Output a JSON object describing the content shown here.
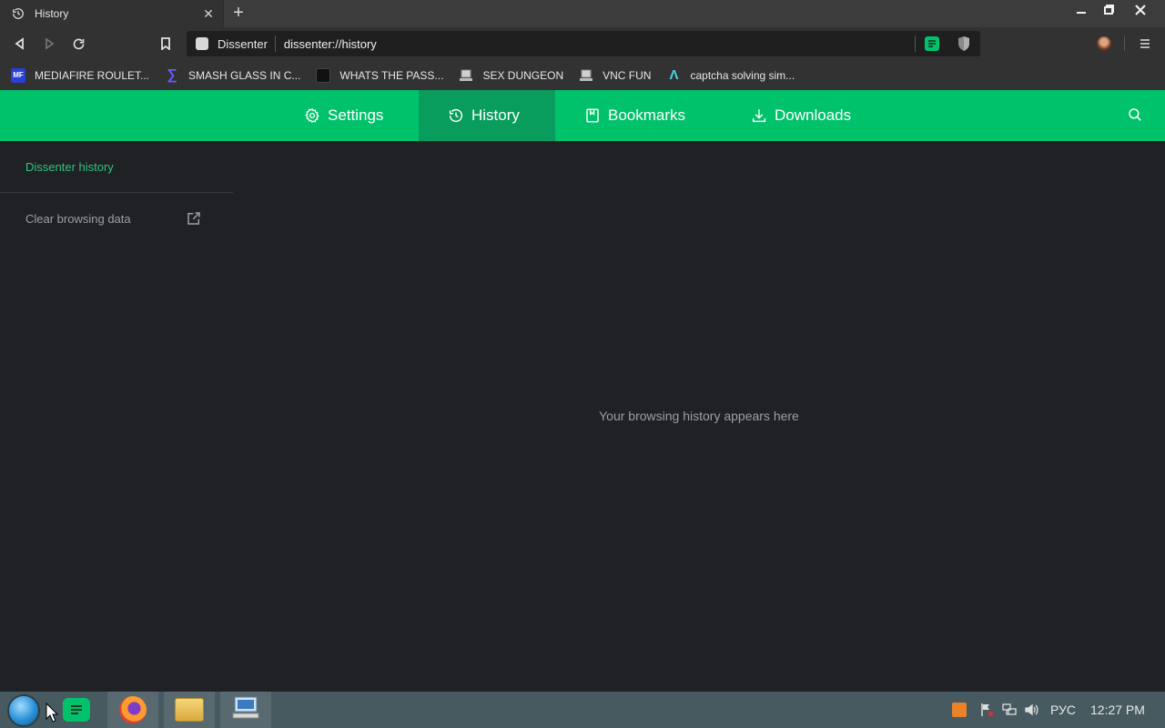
{
  "browser": {
    "tab": {
      "title": "History",
      "icon": "history-icon"
    },
    "new_tab_label": "+",
    "omnibox": {
      "site_name": "Dissenter",
      "url": "dissenter://history"
    },
    "bookmarks": [
      {
        "label": "MEDIAFIRE ROULET...",
        "icon": "mediafire-icon"
      },
      {
        "label": "SMASH GLASS IN C...",
        "icon": "sigma-icon"
      },
      {
        "label": "WHATS THE PASS...",
        "icon": "dark-square-icon"
      },
      {
        "label": "SEX DUNGEON",
        "icon": "computer-icon"
      },
      {
        "label": "VNC FUN",
        "icon": "computer-icon"
      },
      {
        "label": "captcha solving sim...",
        "icon": "lambda-icon"
      }
    ]
  },
  "nav": {
    "tabs": [
      {
        "label": "Settings",
        "icon": "gear-icon"
      },
      {
        "label": "History",
        "icon": "history-icon",
        "active": true
      },
      {
        "label": "Bookmarks",
        "icon": "bookmark-icon"
      },
      {
        "label": "Downloads",
        "icon": "download-icon"
      }
    ]
  },
  "sidebar": {
    "title": "Dissenter history",
    "clear_label": "Clear browsing data"
  },
  "main": {
    "empty_message": "Your browsing history appears here"
  },
  "taskbar": {
    "language": "РУС",
    "time": "12:27 PM"
  },
  "colors": {
    "accent": "#00c26b",
    "accent_active": "#089d5c",
    "background": "#202124",
    "chrome": "#323232"
  }
}
